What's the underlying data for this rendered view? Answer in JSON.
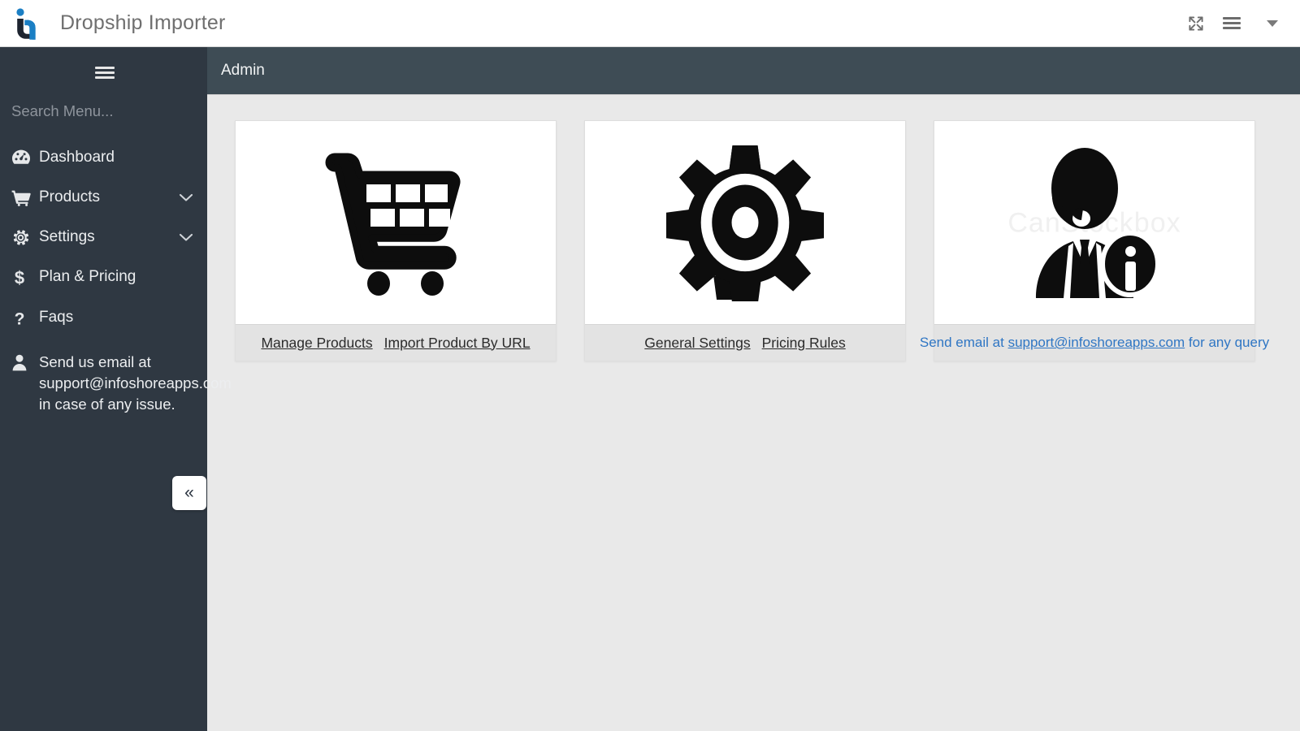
{
  "topbar": {
    "brand_title": "Dropship Importer",
    "logo_name": "infoshore-logo",
    "logo_colors": {
      "blue": "#1b7fc4",
      "dark": "#1d2430"
    },
    "icons": [
      {
        "name": "fullscreen-icon",
        "label": "Fullscreen"
      },
      {
        "name": "menu-icon",
        "label": "Menu"
      },
      {
        "name": "chevron-down-icon",
        "label": "Account menu"
      }
    ]
  },
  "sidebar": {
    "background": "#2f3842",
    "toggle_name": "sidebar-menu-toggle",
    "search": {
      "placeholder": "Search Menu...",
      "value": ""
    },
    "items": [
      {
        "label": "Dashboard",
        "icon": "dashboard-icon",
        "chevron": false
      },
      {
        "label": "Products",
        "icon": "shopping-cart-icon",
        "chevron": true
      },
      {
        "label": "Settings",
        "icon": "gear-icon",
        "chevron": true
      },
      {
        "label": "Plan & Pricing",
        "icon": "dollar-icon",
        "chevron": false
      },
      {
        "label": "Faqs",
        "icon": "question-icon",
        "chevron": false
      }
    ],
    "note": {
      "icon": "user-icon",
      "text": "Send us email at support@infoshoreapps.com in case of any issue."
    },
    "collapse_label": "«"
  },
  "page": {
    "header_title": "Admin",
    "header_background": "#3e4c55",
    "content_background": "#e9e9e9"
  },
  "cards": [
    {
      "name": "products-card",
      "icon": "shopping-cart-icon",
      "links": [
        {
          "label": "Manage Products",
          "style": "dark"
        },
        {
          "label": "Import Product By URL",
          "style": "dark"
        }
      ]
    },
    {
      "name": "settings-card",
      "icon": "gear-icon",
      "links": [
        {
          "label": "General Settings",
          "style": "dark"
        },
        {
          "label": "Pricing Rules",
          "style": "dark"
        }
      ]
    },
    {
      "name": "support-card",
      "icon": "support-agent-icon",
      "watermark": "CanStockbox",
      "footer_blue": {
        "prefix": "Send email at ",
        "email": "support@infoshoreapps.com",
        "suffix": " for any query",
        "color": "#2f76c4"
      }
    }
  ]
}
